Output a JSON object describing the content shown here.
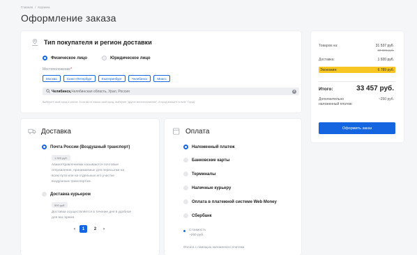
{
  "breadcrumb": {
    "home": "Главная",
    "separator": "/",
    "current": "Корзина"
  },
  "page_title": "Оформление заказа",
  "buyer": {
    "title": "Тип покупателя и регион доставки",
    "types": [
      {
        "label": "Физическое лицо",
        "selected": true
      },
      {
        "label": "Юридическое лицо",
        "selected": false
      }
    ],
    "location_label": "Местоположение",
    "required_mark": "*",
    "cities": [
      "Москва",
      "Санкт-Петербург",
      "Екатеринбург",
      "Челябинск",
      "Миасс"
    ],
    "search_icon": "search-icon",
    "search_bold": "Челябинск,",
    "search_rest": " Челябинская область, Урал, Россия",
    "hint": "Выберите свой город в списке. Если вы не нашли свой город, выберите \"другое местоположение\", а город впишите в поле \"Город\""
  },
  "delivery": {
    "title": "Доставка",
    "options": [
      {
        "label": "Почта России (Воздушный транспорт)",
        "selected": true,
        "price": "1 920 руб.",
        "description_lines": [
          "Авиаотправлениями называются почтовые",
          "отправления, принимаемые для пересылки на",
          "всем пути или на отдельных его участке",
          "воздушным транспортом."
        ]
      },
      {
        "label": "Доставка курьером",
        "selected": false,
        "price": "500 руб.",
        "description_lines": [
          "Доставка осуществляется в течение дня в удобное",
          "для вас время."
        ]
      }
    ],
    "pagination": {
      "prev": "‹",
      "pages": [
        "1",
        "2"
      ],
      "current": "1",
      "next": "›"
    }
  },
  "payment": {
    "title": "Оплата",
    "options": [
      {
        "label": "Наложенный платеж",
        "selected": true
      },
      {
        "label": "Банковские карты",
        "selected": false
      },
      {
        "label": "Терминалы",
        "selected": false
      },
      {
        "label": "Наличные курьеру",
        "selected": false
      },
      {
        "label": "Оплата в платежной системе Web Money",
        "selected": false
      },
      {
        "label": "Сбербанк",
        "selected": false
      }
    ],
    "cost_label": "Стоимость",
    "cost_value": "~250 руб.",
    "note": "Оплата с помощью наложенного платежа"
  },
  "summary": {
    "goods_label": "Товаров на:",
    "goods_value": "31 537 руб.",
    "goods_old": "38 326 руб.",
    "delivery_label": "Доставка:",
    "delivery_value": "1 920 руб.",
    "economy_label": "Экономия:",
    "economy_value": "6 789 руб.",
    "total_label": "Итого:",
    "total_value": "33 457 руб.",
    "extra_label": "Дополнительно наложенный платеж:",
    "extra_value": "~250 руб.",
    "order_button": "Оформить заказ"
  },
  "colors": {
    "accent": "#1565e0",
    "economy": "#f7c623",
    "background": "#f5f6f8"
  }
}
